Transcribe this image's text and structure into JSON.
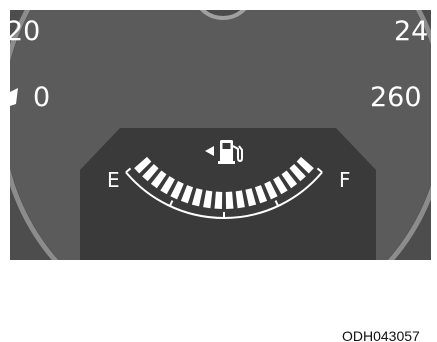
{
  "figure": {
    "speed_labels": {
      "top_left": "20",
      "mid_left": "0",
      "top_right": "24",
      "mid_right": "260"
    },
    "fuel_gauge": {
      "empty_label": "E",
      "full_label": "F",
      "fuel_level": 1.0,
      "filler_side_indicator": "left",
      "icon": "fuel-pump-icon"
    },
    "image_code": "ODH043057"
  },
  "colors": {
    "cluster_outer": "#4d4d4d",
    "cluster_face": "#5b5b5b",
    "gauge_panel": "#3a3a3a",
    "bezel_ring": "#8c8c8c",
    "markings": "#ffffff"
  }
}
